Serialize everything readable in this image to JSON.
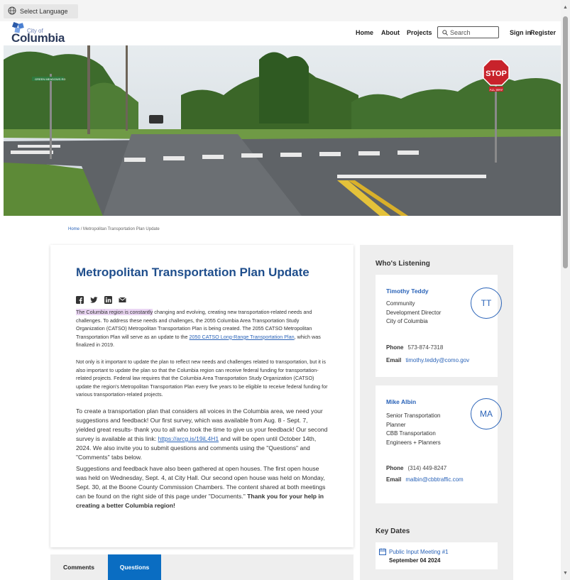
{
  "top_bar": {
    "language_label": "Select Language"
  },
  "header": {
    "logo_city": "City of",
    "logo_name": "Columbia",
    "nav": [
      "Home",
      "About",
      "Projects"
    ],
    "search_placeholder": "Search",
    "sign_in": "Sign in",
    "register": "Register"
  },
  "hero": {
    "street_sign": "GREEN MEADOWS RD",
    "stop_sign": "STOP",
    "all_way": "ALL WAY"
  },
  "breadcrumb": {
    "home": "Home",
    "separator": "/",
    "current": "Metropolitan Transportation Plan Update"
  },
  "main": {
    "title": "Metropolitan Transportation Plan Update",
    "social_icons": [
      "facebook-icon",
      "twitter-icon",
      "linkedin-icon",
      "email-icon"
    ],
    "p1_highlight": "The Columbia region is constantly",
    "p1_rest_a": " changing and evolving, creating new transportation-related needs and challenges. To address these needs and challenges, the 2055 Columbia Area Transportation Study Organization (CATSO) Metropolitan Transportation Plan is being created. The 2055 CATSO Metropolitan Transportation Plan will serve as an update to the ",
    "p1_link": "2050 CATSO Long-Range Transportation Plan",
    "p1_rest_b": ", which was finalized in 2019.",
    "p2": "Not only is it important to update the plan to reflect new needs and challenges related to transportation, but it is also important to update the plan so that the Columbia region can receive federal funding for transportation-related projects. Federal law requires that the Columbia Area Transportation Study Organization (CATSO) update the region's Metropolitan Transportation Plan every five years to be eligible to receive federal funding for various transportation-related projects.",
    "p3_a": "To create a transportation plan that considers all voices in the Columbia area, we need your suggestions and feedback! Our first survey, which was available from Aug. 8 - Sept. 7, yielded great results- thank you to all who took the time to give us your feedback! Our second survey is available at this link: ",
    "p3_link": "https://arcg.is/19iL4H1",
    "p3_b": " and will be open until October 14th, 2024. We also invite you to submit questions and comments using the \"Questions\" and \"Comments\" tabs below.",
    "p4_a": "Suggestions and feedback have also been gathered at open houses. The first open house was held on Wednesday, Sept. 4, at City Hall. Our second open house was held on Monday, Sept. 30, at the Boone County Commission Chambers. The content shared at both meetings can be found on the right side of this page under \"Documents.\" ",
    "p4_bold": "Thank you for your help in creating a better Columbia region!"
  },
  "sidebar": {
    "listening_title": "Who's Listening",
    "people": [
      {
        "name": "Timothy Teddy",
        "role_lines": [
          "Community",
          "Development Director",
          "City of Columbia"
        ],
        "initials": "TT",
        "phone_label": "Phone",
        "phone": "573-874-7318",
        "email_label": "Email",
        "email": "timothy.teddy@como.gov"
      },
      {
        "name": "Mike Albin",
        "role_lines": [
          "Senior Transportation",
          "Planner",
          "CBB Transportation",
          "Engineers + Planners"
        ],
        "initials": "MA",
        "phone_label": "Phone",
        "phone": "(314) 449-8247",
        "email_label": "Email",
        "email": "malbin@cbbtraffic.com"
      }
    ],
    "key_dates_title": "Key Dates",
    "key_date_event": "Public Input Meeting #1",
    "key_date_date": "September 04 2024"
  },
  "tabs": {
    "comments": "Comments",
    "questions": "Questions",
    "active_color": "#0a6dc2"
  },
  "colors": {
    "title_blue": "#1f4e8c",
    "link_blue": "#2a63b8",
    "highlight": "#ead6f3"
  }
}
